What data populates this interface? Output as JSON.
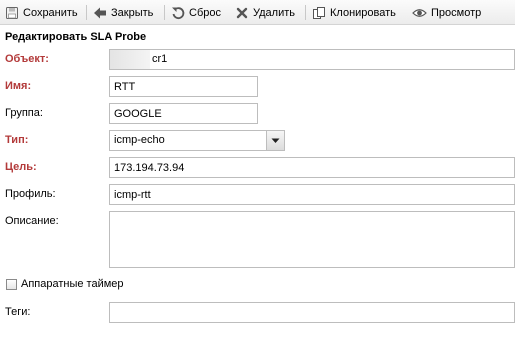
{
  "toolbar": {
    "save": "Сохранить",
    "close": "Закрыть",
    "reset": "Сброс",
    "delete": "Удалить",
    "clone": "Клонировать",
    "preview": "Просмотр"
  },
  "form": {
    "title": "Редактировать SLA Probe",
    "object": {
      "label": "Объект:",
      "value": "cr1"
    },
    "name": {
      "label": "Имя:",
      "value": "RTT"
    },
    "group": {
      "label": "Группа:",
      "value": "GOOGLE"
    },
    "type": {
      "label": "Тип:",
      "value": "icmp-echo"
    },
    "target": {
      "label": "Цель:",
      "value": "173.194.73.94"
    },
    "profile": {
      "label": "Профиль:",
      "value": "icmp-rtt"
    },
    "description": {
      "label": "Описание:",
      "value": ""
    },
    "hw_timers": {
      "label": "Аппаратные таймер",
      "checked": false
    },
    "tags": {
      "label": "Теги:",
      "value": ""
    }
  },
  "colors": {
    "required_label": "#b33a3a"
  }
}
